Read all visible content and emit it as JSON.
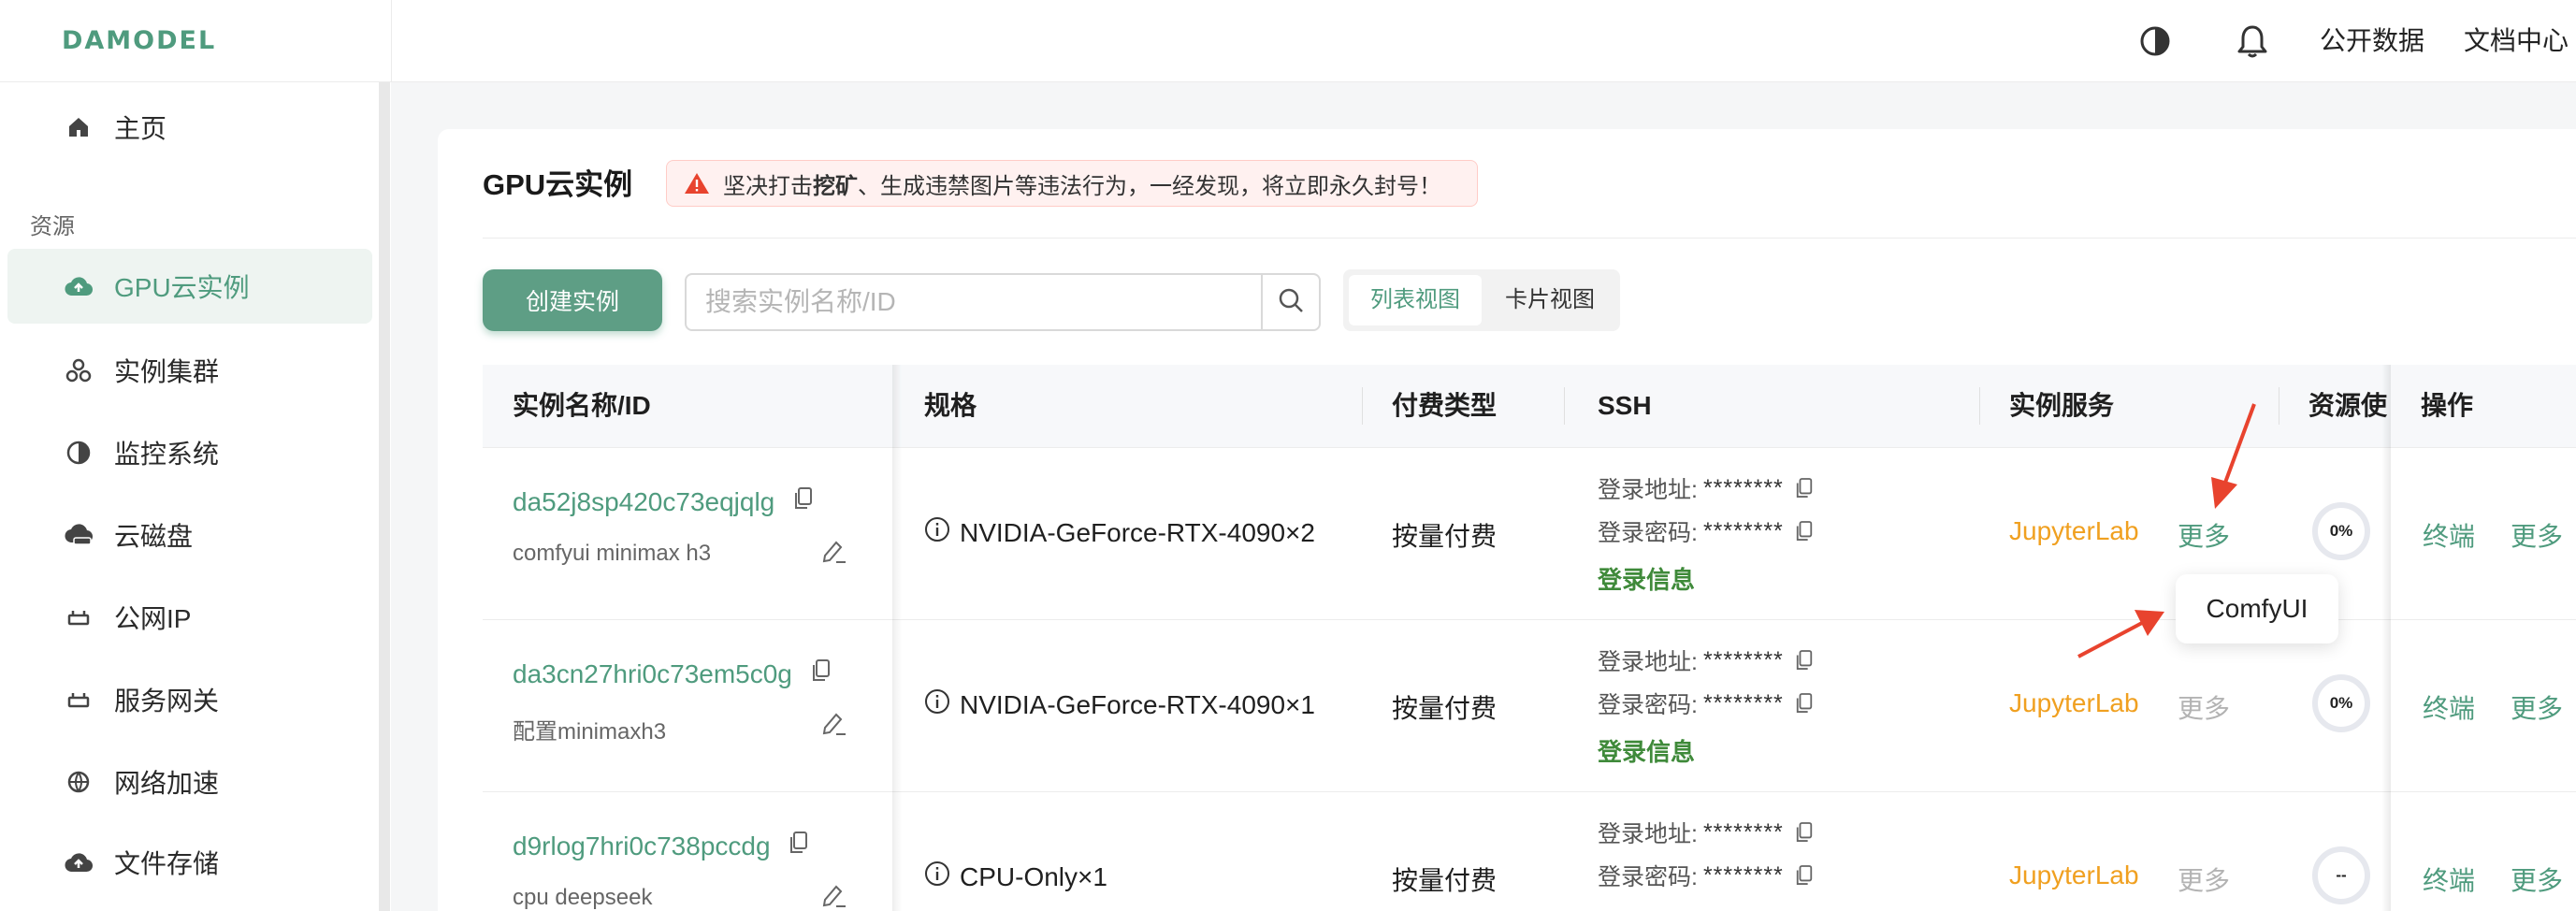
{
  "app": {
    "logo": "DAMODEL"
  },
  "header": {
    "public_data": "公开数据",
    "docs": "文档中心"
  },
  "sidebar": {
    "home": "主页",
    "section_label": "资源",
    "items": [
      {
        "label": "GPU云实例",
        "icon": "cloud-upload-icon",
        "active": true
      },
      {
        "label": "实例集群",
        "icon": "cluster-icon"
      },
      {
        "label": "监控系统",
        "icon": "half-circle-icon"
      },
      {
        "label": "云磁盘",
        "icon": "cloud-disk-icon"
      },
      {
        "label": "公网IP",
        "icon": "network-icon"
      },
      {
        "label": "服务网关",
        "icon": "gateway-icon"
      },
      {
        "label": "网络加速",
        "icon": "globe-icon"
      },
      {
        "label": "文件存储",
        "icon": "cloud-upload-icon"
      }
    ]
  },
  "page": {
    "title": "GPU云实例",
    "warning_prefix": "坚决打击 ",
    "warning_bold": "挖矿",
    "warning_suffix": "、生成违禁图片等违法行为，一经发现，将立即永久封号！"
  },
  "toolbar": {
    "create_button": "创建实例",
    "search_placeholder": "搜索实例名称/ID",
    "view_list": "列表视图",
    "view_card": "卡片视图"
  },
  "table": {
    "headers": {
      "name": "实例名称/ID",
      "spec": "规格",
      "billing": "付费类型",
      "ssh": "SSH",
      "service": "实例服务",
      "resource": "资源使",
      "ops": "操作"
    },
    "ssh_addr_label": "登录地址:",
    "ssh_pwd_label": "登录密码:",
    "ssh_mask": "********",
    "ssh_info": "登录信息",
    "rows": [
      {
        "id": "da52j8sp420c73eqjqlg",
        "name": "comfyui minimax h3",
        "spec": "NVIDIA-GeForce-RTX-4090×2",
        "billing": "按量付费",
        "service": "JupyterLab",
        "more": "更多",
        "usage": "0%",
        "terminal": "终端",
        "op_more": "更多"
      },
      {
        "id": "da3cn27hri0c73em5c0g",
        "name": "配置minimaxh3",
        "spec": "NVIDIA-GeForce-RTX-4090×1",
        "billing": "按量付费",
        "service": "JupyterLab",
        "more": "更多",
        "usage": "0%",
        "terminal": "终端",
        "op_more": "更多"
      },
      {
        "id": "d9rlog7hri0c738pccdg",
        "name": "cpu deepseek",
        "spec": "CPU-Only×1",
        "billing": "按量付费",
        "service": "JupyterLab",
        "more": "更多",
        "usage": "--",
        "terminal": "终端",
        "op_more": "更多"
      }
    ]
  },
  "popover": {
    "item": "ComfyUI"
  },
  "colors": {
    "accent": "#4f9b7e",
    "warning_bg": "#fff1f0",
    "jupyter": "#f0a020",
    "arrow": "#e8432e"
  }
}
